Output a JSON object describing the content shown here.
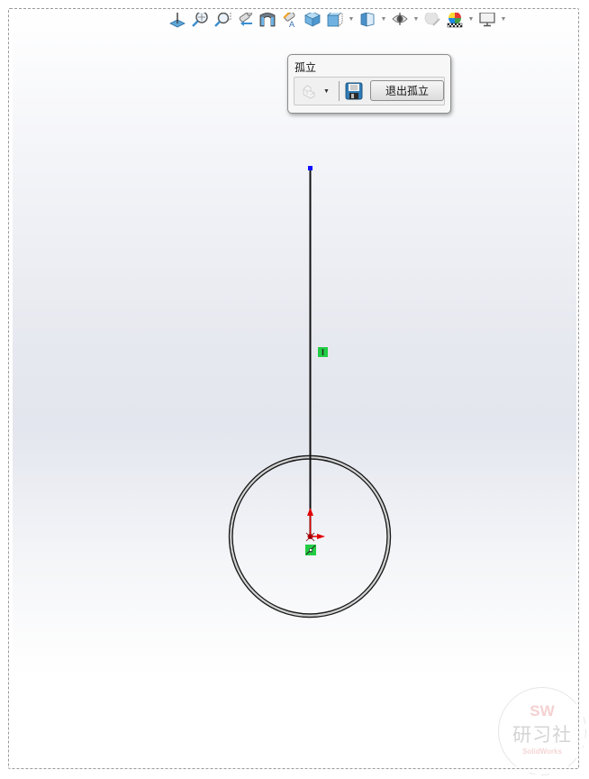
{
  "toolbar": {
    "items": [
      {
        "icon": "normal-to-icon",
        "has_dropdown": false
      },
      {
        "icon": "zoom-to-fit-icon",
        "has_dropdown": false
      },
      {
        "icon": "zoom-to-area-icon",
        "has_dropdown": false
      },
      {
        "icon": "previous-view-icon",
        "has_dropdown": false
      },
      {
        "icon": "section-view-icon",
        "has_dropdown": false
      },
      {
        "icon": "dynamic-annotation-views-icon",
        "has_dropdown": false
      },
      {
        "icon": "view-orientation-icon",
        "has_dropdown": false
      },
      {
        "icon": "display-style-icon",
        "has_dropdown": true
      },
      {
        "icon": "shaded-view-icon",
        "has_dropdown": true
      },
      {
        "icon": "hide-show-items-icon",
        "has_dropdown": true
      },
      {
        "icon": "edit-appearance-icon",
        "has_dropdown": false
      },
      {
        "icon": "apply-scene-icon",
        "has_dropdown": true
      },
      {
        "icon": "view-settings-icon",
        "has_dropdown": true
      }
    ]
  },
  "isolate": {
    "title": "孤立",
    "display_icon": "isolated-display-icon",
    "save_icon": "save-as-display-state-icon",
    "exit_label": "退出孤立"
  },
  "sketch": {
    "line_color": "#000000",
    "endpoint_color": "#0000ff",
    "origin_color": "#e00000",
    "relation_badge_color": "#22cc44",
    "vertical_relation_glyph": "|",
    "coincident_relation_icon": "coincident-relation-icon"
  },
  "watermark": {
    "top": "SW",
    "main": "研习社",
    "sub": "SolidWorks"
  }
}
